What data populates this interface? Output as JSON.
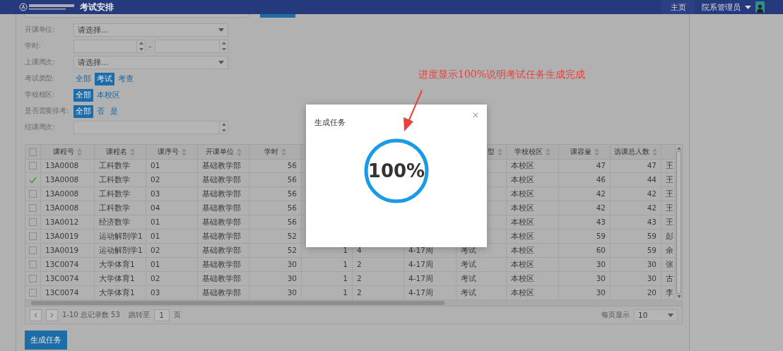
{
  "top_bar": {
    "title": "考试安排",
    "home": "主页",
    "user": "院系管理员"
  },
  "filters": [
    {
      "kind": "select",
      "label": "开课单位:",
      "placeholder": "请选择..."
    },
    {
      "kind": "range",
      "label": "学时:",
      "separator": "–"
    },
    {
      "kind": "select",
      "label": "上课周次:",
      "placeholder": "请选择..."
    },
    {
      "kind": "chips",
      "label": "考试类型:",
      "options": [
        {
          "label": "全部",
          "selected": false
        },
        {
          "label": "考试",
          "selected": true
        },
        {
          "label": "考查",
          "selected": false
        }
      ]
    },
    {
      "kind": "chips",
      "label": "学校校区:",
      "options": [
        {
          "label": "全部",
          "selected": true
        },
        {
          "label": "本校区",
          "selected": false
        }
      ]
    },
    {
      "kind": "chips",
      "label": "是否需要排考:",
      "options": [
        {
          "label": "全部",
          "selected": true
        },
        {
          "label": "否",
          "selected": false
        },
        {
          "label": "是",
          "selected": false
        }
      ]
    },
    {
      "kind": "spinner",
      "label": "结课周次:"
    }
  ],
  "table": {
    "all_checked": false,
    "columns": [
      {
        "label": "课程号",
        "kind": "text"
      },
      {
        "label": "课程名",
        "kind": "text"
      },
      {
        "label": "课序号",
        "kind": "text"
      },
      {
        "label": "开课单位",
        "kind": "text"
      },
      {
        "label": "学时",
        "kind": "number"
      },
      {
        "kind": "number"
      },
      {
        "kind": "text"
      },
      {
        "kind": "text"
      },
      {
        "label": "型",
        "kind": "text",
        "cut_left": true
      },
      {
        "label": "学校校区",
        "kind": "text"
      },
      {
        "label": "课容量",
        "kind": "number"
      },
      {
        "label": "选课总人数",
        "kind": "number"
      },
      {
        "kind": "text"
      }
    ],
    "rows": [
      {
        "checked": false,
        "cells": [
          "13A0008",
          "工科数学",
          "01",
          "基础教学部",
          "56",
          null,
          null,
          null,
          null,
          "本校区",
          "47",
          "47",
          "王"
        ]
      },
      {
        "checked": true,
        "cells": [
          "13A0008",
          "工科数学",
          "02",
          "基础教学部",
          "56",
          null,
          null,
          null,
          null,
          "本校区",
          "46",
          "44",
          "王"
        ]
      },
      {
        "checked": false,
        "cells": [
          "13A0008",
          "工科数学",
          "03",
          "基础教学部",
          "56",
          null,
          null,
          null,
          null,
          "本校区",
          "42",
          "42",
          "王"
        ]
      },
      {
        "checked": false,
        "cells": [
          "13A0008",
          "工科数学",
          "04",
          "基础教学部",
          "56",
          null,
          null,
          null,
          null,
          "本校区",
          "42",
          "42",
          "王"
        ]
      },
      {
        "checked": false,
        "cells": [
          "13A0012",
          "经济数学",
          "01",
          "基础教学部",
          "56",
          null,
          null,
          null,
          null,
          "本校区",
          "43",
          "43",
          "王"
        ]
      },
      {
        "checked": false,
        "cells": [
          "13A0019",
          "运动解剖学1",
          "01",
          "基础教学部",
          "52",
          null,
          null,
          null,
          null,
          "本校区",
          "59",
          "59",
          "彭"
        ]
      },
      {
        "checked": false,
        "cells": [
          "13A0019",
          "运动解剖学1",
          "02",
          "基础教学部",
          "52",
          "1",
          "4",
          "4-17周",
          "考试",
          "本校区",
          "60",
          "59",
          "余"
        ]
      },
      {
        "checked": false,
        "cells": [
          "13C0074",
          "大学体育1",
          "01",
          "基础教学部",
          "30",
          "1",
          "2",
          "4-17周",
          "考试",
          "本校区",
          "30",
          "30",
          "张"
        ]
      },
      {
        "checked": false,
        "cells": [
          "13C0074",
          "大学体育1",
          "02",
          "基础教学部",
          "30",
          "1",
          "2",
          "4-17周",
          "考试",
          "本校区",
          "30",
          "30",
          "古"
        ]
      },
      {
        "checked": false,
        "cells": [
          "13C0074",
          "大学体育1",
          "03",
          "基础教学部",
          "30",
          "1",
          "2",
          "4-17周",
          "考试",
          "本校区",
          "30",
          "20",
          "李"
        ]
      }
    ]
  },
  "pager": {
    "summary": "1-10 总记录数 53",
    "goto_label": "跳转至",
    "page": "1",
    "page_unit": "页",
    "per_page_label": "每页显示",
    "per_page": "10"
  },
  "generate_button": "生成任务",
  "dialog": {
    "title": "生成任务",
    "progress": "100%",
    "level": 1
  },
  "annotation": "进度显示100%说明考试任务生成完成"
}
